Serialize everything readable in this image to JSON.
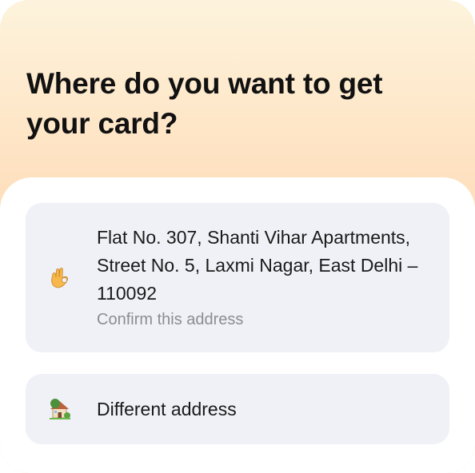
{
  "heading": "Where do you want to get your card?",
  "options": [
    {
      "icon": "ok-hand-icon",
      "address": "Flat No. 307, Shanti Vihar Apartments, Street No. 5, Laxmi Nagar, East Delhi – 110092",
      "hint": "Confirm this address"
    },
    {
      "icon": "house-with-garden-icon",
      "label": "Different address"
    }
  ],
  "colors": {
    "gradient_top": "#fdf3dc",
    "gradient_bottom": "#feccb0",
    "option_background": "#eff1f6",
    "hint_text": "#8a8d95"
  }
}
